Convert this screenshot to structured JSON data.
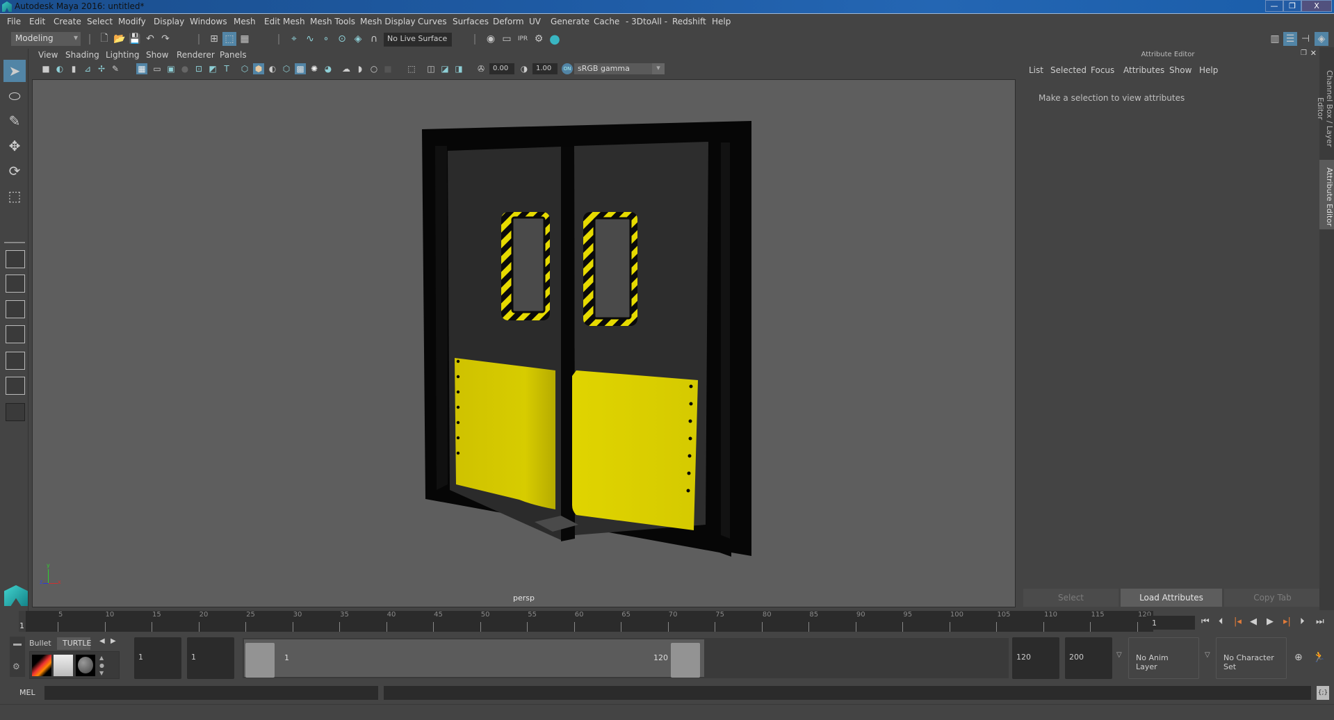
{
  "window": {
    "title": "Autodesk Maya 2016: untitled*",
    "controls": {
      "minimize": "—",
      "restore": "❐",
      "close": "X"
    }
  },
  "menubar": [
    "File",
    "Edit",
    "Create",
    "Select",
    "Modify",
    "Display",
    "Windows",
    "Mesh",
    "Edit Mesh",
    "Mesh Tools",
    "Mesh Display",
    "Curves",
    "Surfaces",
    "Deform",
    "UV",
    "Generate",
    "Cache",
    "- 3DtoAll -",
    "Redshift",
    "Help"
  ],
  "statusline": {
    "menuset": "Modeling",
    "live_surface": "No Live Surface",
    "icons": [
      "new-scene-icon",
      "open-scene-icon",
      "save-scene-icon",
      "undo-icon",
      "redo-icon",
      "select-hierarchy-icon",
      "select-object-icon",
      "select-component-icon",
      "snap-grid-icon",
      "snap-curve-icon",
      "snap-point-icon",
      "snap-view-plane-icon",
      "snap-live-icon",
      "snap-magnet-icon",
      "render-view-icon",
      "render-current-icon",
      "ipr-render-icon",
      "render-settings-icon",
      "hypershade-icon"
    ],
    "right_icons": [
      "modeling-toolkit-icon",
      "attribute-editor-toggle-icon",
      "tool-settings-icon",
      "channel-box-icon"
    ]
  },
  "toolbox": {
    "tools": [
      "select-tool-icon",
      "lasso-tool-icon",
      "paint-select-tool-icon",
      "move-tool-icon",
      "rotate-tool-icon",
      "scale-tool-icon"
    ],
    "layouts": [
      "single-perspective-layout",
      "four-view-layout",
      "persp-outliner-layout",
      "persp-graph-layout",
      "outliner-graph-layout",
      "hypershade-layout",
      "layout-options"
    ]
  },
  "viewport": {
    "menus": [
      "View",
      "Shading",
      "Lighting",
      "Show",
      "Renderer",
      "Panels"
    ],
    "exposure": "0.00",
    "gamma": "1.00",
    "color_mgmt_toggle": "ON",
    "view_transform": "sRGB gamma",
    "camera_label": "persp",
    "axis": {
      "x": "x",
      "y": "y",
      "z": "z"
    },
    "colors": {
      "door_frame": "#050505",
      "door_panel": "#2a2a2a",
      "kick_plate": "#d8cb00",
      "hazard_yellow": "#e8dc00",
      "window_glass": "#4a4a4a",
      "background": "#5e5e5e"
    }
  },
  "attribute_editor": {
    "title": "Attribute Editor",
    "menus": [
      "List",
      "Selected",
      "Focus",
      "Attributes",
      "Show",
      "Help"
    ],
    "message": "Make a selection to view attributes",
    "buttons": [
      {
        "label": "Select",
        "enabled": false
      },
      {
        "label": "Load Attributes",
        "enabled": true
      },
      {
        "label": "Copy Tab",
        "enabled": false
      }
    ]
  },
  "side_tabs": [
    "Channel Box / Layer Editor",
    "Attribute Editor"
  ],
  "timeline": {
    "ticks": [
      "5",
      "10",
      "15",
      "20",
      "25",
      "30",
      "35",
      "40",
      "45",
      "50",
      "55",
      "60",
      "65",
      "70",
      "75",
      "80",
      "85",
      "90",
      "95",
      "100",
      "105",
      "110",
      "115",
      "120"
    ],
    "current_frame_marker": "1",
    "current_frame_field": "1",
    "range_start": 1,
    "range_end": 120
  },
  "playback_controls": [
    "go-to-start-icon",
    "step-back-key-icon",
    "step-back-frame-icon",
    "play-backwards-icon",
    "play-forwards-icon",
    "step-forward-frame-icon",
    "step-forward-key-icon",
    "go-to-end-icon"
  ],
  "range_slider": {
    "start_time": "1",
    "playback_start": "1",
    "range_start_label": "1",
    "range_end_label": "120",
    "playback_end": "120",
    "end_time": "200",
    "anim_layer": "No Anim Layer",
    "character_set": "No Character Set"
  },
  "shelf": {
    "tabs": [
      "Bullet",
      "TURTLE"
    ],
    "active_tab": "TURTLE",
    "items": [
      "turtle-render-icon",
      "turtle-bake-icon",
      "turtle-surface-icon"
    ]
  },
  "command_line": {
    "label": "MEL",
    "input": "",
    "output": ""
  }
}
